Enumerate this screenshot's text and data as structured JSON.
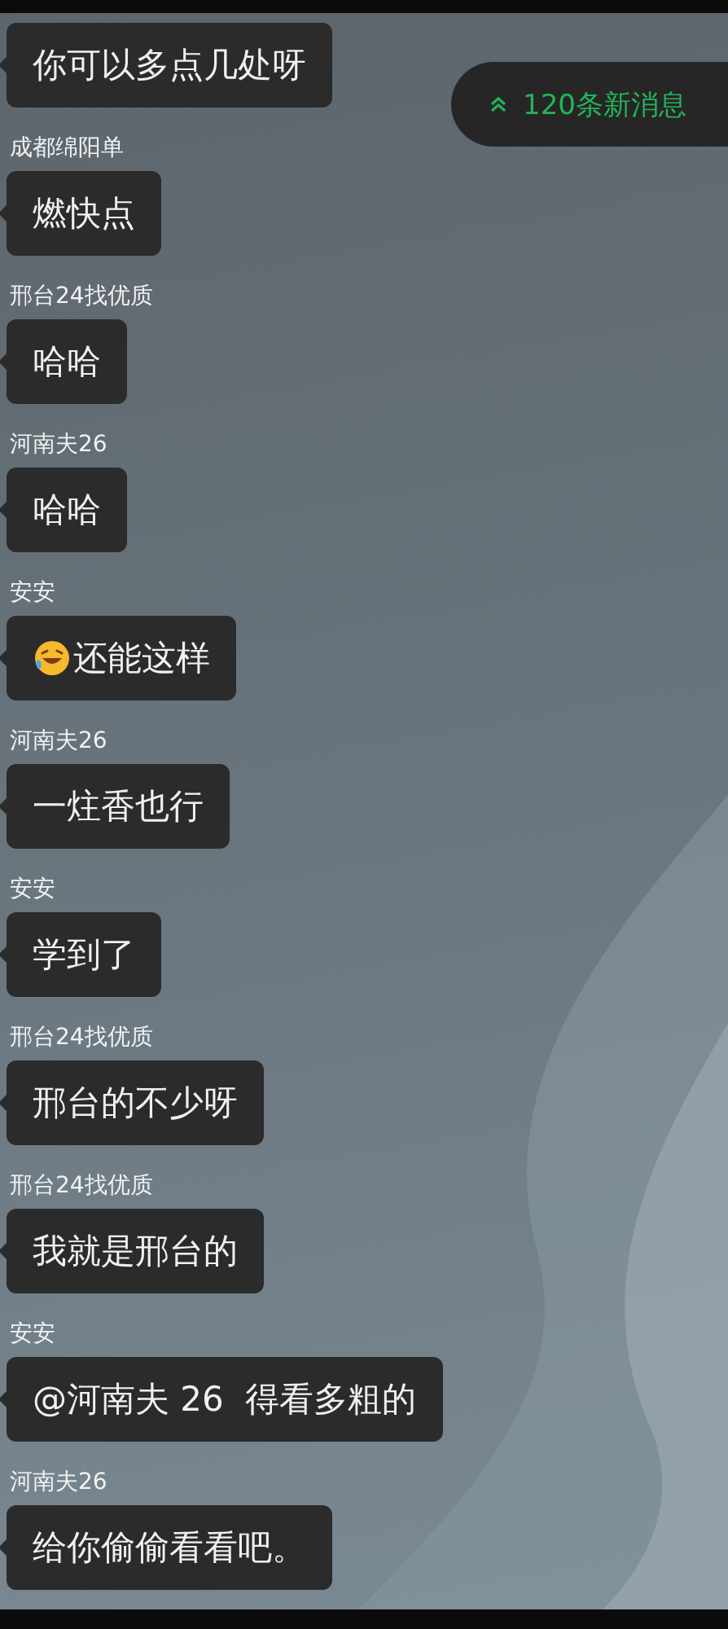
{
  "new_messages_button": {
    "label": "120条新消息"
  },
  "messages": [
    {
      "kind": "text",
      "text": "你可以多点几处呀"
    },
    {
      "kind": "text",
      "sender": "成都绵阳单",
      "text": "燃快点"
    },
    {
      "kind": "text",
      "sender": "邢台24找优质",
      "text": "哈哈"
    },
    {
      "kind": "text",
      "sender": "河南夫26",
      "text": "哈哈"
    },
    {
      "kind": "emoji",
      "sender": "安安",
      "text": "还能这样"
    },
    {
      "kind": "text",
      "sender": "河南夫26",
      "text": "一炷香也行"
    },
    {
      "kind": "text",
      "sender": "安安",
      "text": "学到了"
    },
    {
      "kind": "text",
      "sender": "邢台24找优质",
      "text": "邢台的不少呀"
    },
    {
      "kind": "text",
      "sender": "邢台24找优质",
      "text": "我就是邢台的"
    },
    {
      "kind": "text",
      "sender": "安安",
      "text": "@河南夫 26  得看多粗的"
    },
    {
      "kind": "text",
      "sender": "河南夫26",
      "text": "给你偷偷看看吧。"
    }
  ]
}
